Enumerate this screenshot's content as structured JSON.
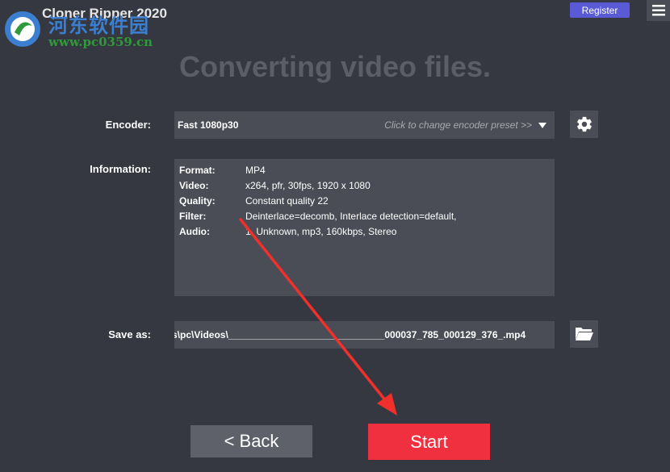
{
  "app": {
    "title": "Cloner Ripper 2020"
  },
  "watermark": {
    "name": "河东软件园",
    "url": "www.pc0359.cn"
  },
  "header": {
    "register_label": "Register",
    "menu_icon": "hamburger-menu-icon"
  },
  "main": {
    "title": "Converting video files."
  },
  "encoder": {
    "label": "Encoder:",
    "value": "Fast 1080p30",
    "hint": "Click to change encoder preset >>",
    "settings_icon": "gear-icon"
  },
  "information": {
    "label": "Information:",
    "rows": [
      {
        "key": "Format:",
        "value": "MP4"
      },
      {
        "key": "Video:",
        "value": "x264, pfr, 30fps, 1920 x 1080"
      },
      {
        "key": "Quality:",
        "value": "Constant quality 22"
      },
      {
        "key": "Filter:",
        "value": "Deinterlace=decomb, Interlace detection=default,"
      },
      {
        "key": "Audio:",
        "value": "1. Unknown, mp3, 160kbps, Stereo"
      }
    ]
  },
  "save_as": {
    "label": "Save as:",
    "value": "s\\pc\\Videos\\_____________________________000037_785_000129_376_.mp4",
    "browse_icon": "folder-open-icon"
  },
  "footer": {
    "back_label": "<  Back",
    "start_label": "Start"
  },
  "colors": {
    "background": "#353840",
    "field": "#4a4d55",
    "start": "#f0303f",
    "register": "#5a59d6",
    "annotation_arrow": "#f0302a"
  }
}
